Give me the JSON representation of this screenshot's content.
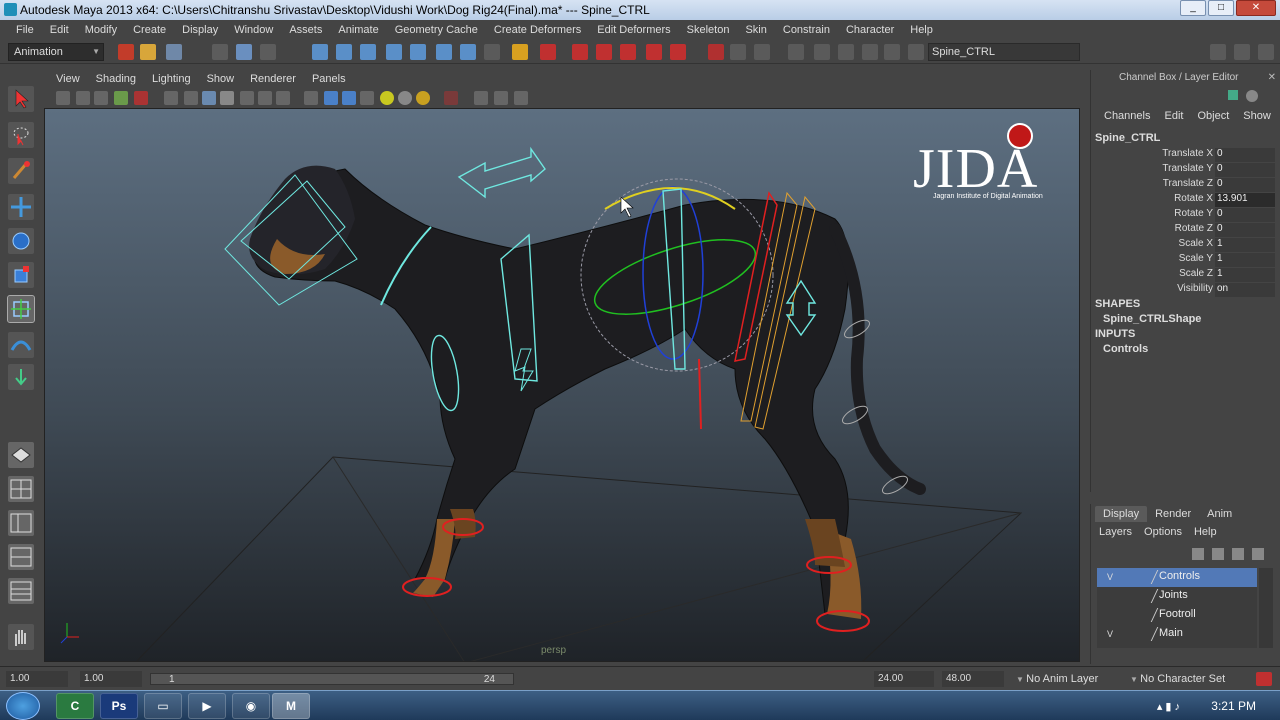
{
  "window": {
    "title": "Autodesk Maya 2013 x64: C:\\Users\\Chitranshu Srivastav\\Desktop\\Vidushi Work\\Dog Rig24(Final).ma*   ---   Spine_CTRL"
  },
  "menubar": {
    "items": [
      "File",
      "Edit",
      "Modify",
      "Create",
      "Display",
      "Window",
      "Assets",
      "Animate",
      "Geometry Cache",
      "Create Deformers",
      "Edit Deformers",
      "Skeleton",
      "Skin",
      "Constrain",
      "Character",
      "Help"
    ]
  },
  "statusline": {
    "mode": "Animation",
    "selected_name": "Spine_CTRL"
  },
  "panel": {
    "menus": [
      "View",
      "Shading",
      "Lighting",
      "Show",
      "Renderer",
      "Panels"
    ],
    "camera": "persp"
  },
  "logo": {
    "text": "JIDA",
    "subtitle": "Jagran Institute of Digital Animation"
  },
  "channelbox": {
    "title": "Channel Box / Layer Editor",
    "menus": [
      "Channels",
      "Edit",
      "Object",
      "Show"
    ],
    "object": "Spine_CTRL",
    "attributes": [
      {
        "label": "Translate X",
        "value": "0"
      },
      {
        "label": "Translate Y",
        "value": "0"
      },
      {
        "label": "Translate Z",
        "value": "0"
      },
      {
        "label": "Rotate X",
        "value": "13.901"
      },
      {
        "label": "Rotate Y",
        "value": "0"
      },
      {
        "label": "Rotate Z",
        "value": "0"
      },
      {
        "label": "Scale X",
        "value": "1"
      },
      {
        "label": "Scale Y",
        "value": "1"
      },
      {
        "label": "Scale Z",
        "value": "1"
      },
      {
        "label": "Visibility",
        "value": "on"
      }
    ],
    "shapes_header": "SHAPES",
    "shape": "Spine_CTRLShape",
    "inputs_header": "INPUTS",
    "input": "Controls"
  },
  "layers": {
    "tabs": [
      "Display",
      "Render",
      "Anim"
    ],
    "menus": [
      "Layers",
      "Options",
      "Help"
    ],
    "items": [
      {
        "visible": "V",
        "name": "Controls"
      },
      {
        "visible": "",
        "name": "Joints"
      },
      {
        "visible": "",
        "name": "Footroll"
      },
      {
        "visible": "V",
        "name": "Main"
      }
    ]
  },
  "timeline": {
    "start": "1.00",
    "range_start": "1.00",
    "current_frame": "1",
    "range_end_marker": "24",
    "end": "24.00",
    "max": "48.00",
    "anim_layer": "No Anim Layer",
    "character_set": "No Character Set"
  },
  "taskbar": {
    "time": "3:21 PM"
  },
  "colors": {
    "accent": "#5279b7",
    "control_cyan": "#6fe8e0",
    "control_red": "#e02020",
    "control_orange": "#e0a030"
  }
}
